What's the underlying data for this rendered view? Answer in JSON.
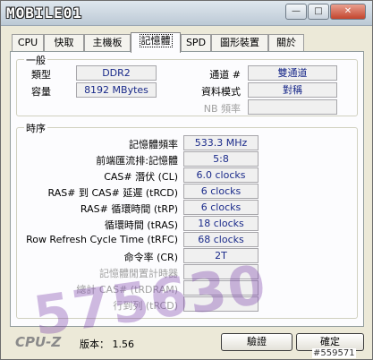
{
  "window": {
    "logo_text": "MOBILE01",
    "controls": {
      "minimize": "—",
      "maximize": "□",
      "close": "✕"
    }
  },
  "tabs": [
    {
      "label": "CPU"
    },
    {
      "label": "快取"
    },
    {
      "label": "主機板"
    },
    {
      "label": "記憶體"
    },
    {
      "label": "SPD"
    },
    {
      "label": "圖形裝置"
    },
    {
      "label": "關於"
    }
  ],
  "active_tab": "記憶體",
  "general": {
    "title": "一般",
    "type_label": "類型",
    "type_value": "DDR2",
    "size_label": "容量",
    "size_value": "8192 MBytes",
    "channels_label": "通道 #",
    "channels_value": "雙通道",
    "dc_mode_label": "資料模式",
    "dc_mode_value": "對稱",
    "nb_freq_label": "NB 頻率",
    "nb_freq_value": ""
  },
  "timings": {
    "title": "時序",
    "rows": [
      {
        "label": "記憶體頻率",
        "value": "533.3 MHz",
        "enabled": true
      },
      {
        "label": "前端匯流排:記憶體",
        "value": "5:8",
        "enabled": true
      },
      {
        "label": "CAS# 潛伏 (CL)",
        "value": "6.0 clocks",
        "enabled": true
      },
      {
        "label": "RAS# 到 CAS# 延遲 (tRCD)",
        "value": "6 clocks",
        "enabled": true
      },
      {
        "label": "RAS# 循環時間 (tRP)",
        "value": "6 clocks",
        "enabled": true
      },
      {
        "label": "循環時間 (tRAS)",
        "value": "18 clocks",
        "enabled": true
      },
      {
        "label": "Row Refresh Cycle Time (tRFC)",
        "value": "68 clocks",
        "enabled": true
      },
      {
        "label": "命令率 (CR)",
        "value": "2T",
        "enabled": true
      },
      {
        "label": "記憶體閒置計時器",
        "value": "",
        "enabled": false
      },
      {
        "label": "總計 CAS# (tRDRAM)",
        "value": "",
        "enabled": false
      },
      {
        "label": "行到列 (tRCD)",
        "value": "",
        "enabled": false
      }
    ]
  },
  "footer": {
    "brand": "CPU-Z",
    "version_label": "版本：",
    "version_value": "1.56",
    "validate_button": "驗證",
    "ok_button": "確定"
  },
  "watermark": "575630",
  "id_tag": "#559571"
}
